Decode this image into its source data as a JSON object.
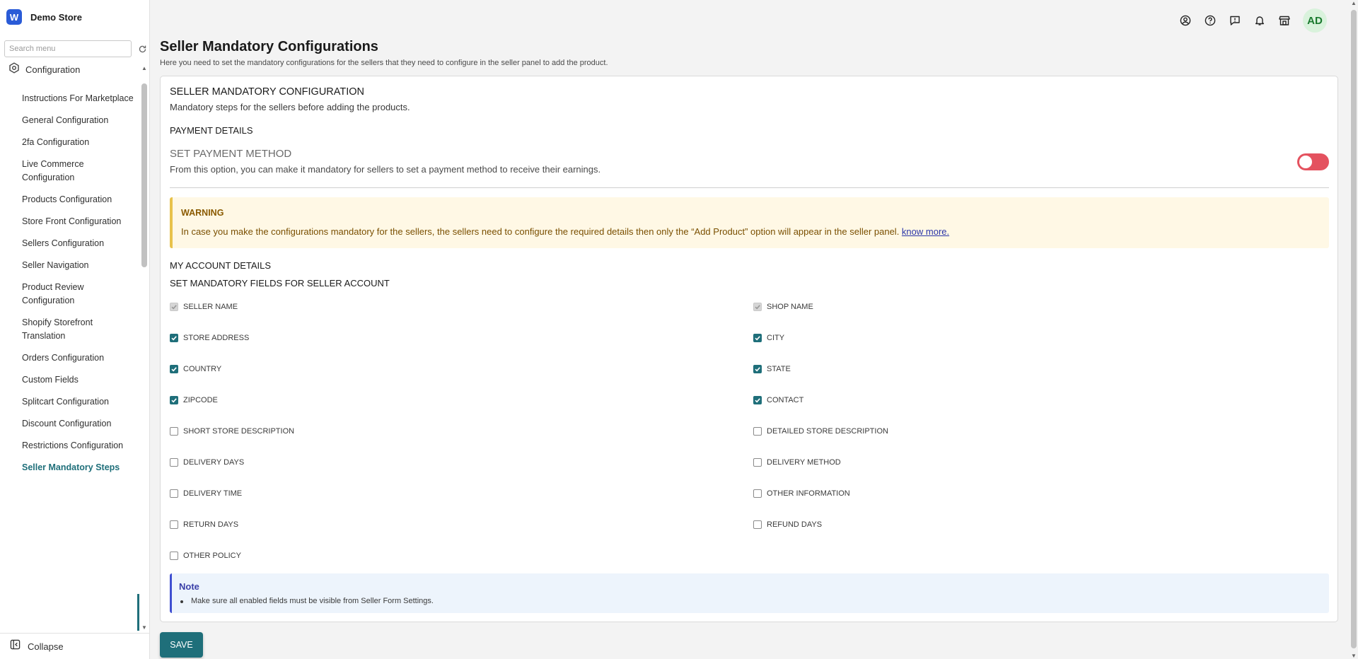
{
  "brand": {
    "name": "Demo Store",
    "logo_text": "W"
  },
  "sidebar": {
    "search_placeholder": "Search menu",
    "section_label": "Configuration",
    "items": [
      {
        "label": "Instructions For Marketplace"
      },
      {
        "label": "General Configuration"
      },
      {
        "label": "2fa Configuration"
      },
      {
        "label": "Live Commerce Configuration"
      },
      {
        "label": "Products Configuration"
      },
      {
        "label": "Store Front Configuration"
      },
      {
        "label": "Sellers Configuration"
      },
      {
        "label": "Seller Navigation"
      },
      {
        "label": "Product Review Configuration"
      },
      {
        "label": "Shopify Storefront Translation"
      },
      {
        "label": "Orders Configuration"
      },
      {
        "label": "Custom Fields"
      },
      {
        "label": "Splitcart Configuration"
      },
      {
        "label": "Discount Configuration"
      },
      {
        "label": "Restrictions Configuration"
      },
      {
        "label": "Seller Mandatory Steps",
        "active": true
      }
    ],
    "collapse_label": "Collapse"
  },
  "topbar": {
    "icons": [
      "user-circle-icon",
      "help-icon",
      "feedback-icon",
      "bell-icon",
      "store-icon"
    ],
    "avatar_initials": "AD"
  },
  "page": {
    "title": "Seller Mandatory Configurations",
    "subtitle": "Here you need to set the mandatory configurations for the sellers that they need to configure in the seller panel to add the product."
  },
  "card": {
    "title": "SELLER MANDATORY CONFIGURATION",
    "subtitle": "Mandatory steps for the sellers before adding the products.",
    "payment_heading": "PAYMENT DETAILS",
    "payment_method_title": "SET PAYMENT METHOD",
    "payment_method_desc": "From this option, you can make it mandatory for sellers to set a payment method to receive their earnings.",
    "payment_toggle_on": false,
    "warning": {
      "title": "WARNING",
      "text": "In case you make the configurations mandatory for the sellers, the sellers need to configure the required details then only the “Add Product” option will appear in the seller panel. ",
      "link": "know more."
    },
    "account_heading": "MY ACCOUNT DETAILS",
    "fields_heading": "SET MANDATORY FIELDS FOR SELLER ACCOUNT",
    "fields": [
      {
        "label": "SELLER NAME",
        "checked": true,
        "disabled": true
      },
      {
        "label": "SHOP NAME",
        "checked": true,
        "disabled": true
      },
      {
        "label": "STORE ADDRESS",
        "checked": true,
        "disabled": false
      },
      {
        "label": "CITY",
        "checked": true,
        "disabled": false
      },
      {
        "label": "COUNTRY",
        "checked": true,
        "disabled": false
      },
      {
        "label": "STATE",
        "checked": true,
        "disabled": false
      },
      {
        "label": "ZIPCODE",
        "checked": true,
        "disabled": false
      },
      {
        "label": "CONTACT",
        "checked": true,
        "disabled": false
      },
      {
        "label": "SHORT STORE DESCRIPTION",
        "checked": false,
        "disabled": false
      },
      {
        "label": "DETAILED STORE DESCRIPTION",
        "checked": false,
        "disabled": false
      },
      {
        "label": "DELIVERY DAYS",
        "checked": false,
        "disabled": false
      },
      {
        "label": "DELIVERY METHOD",
        "checked": false,
        "disabled": false
      },
      {
        "label": "DELIVERY TIME",
        "checked": false,
        "disabled": false
      },
      {
        "label": "OTHER INFORMATION",
        "checked": false,
        "disabled": false
      },
      {
        "label": "RETURN DAYS",
        "checked": false,
        "disabled": false
      },
      {
        "label": "REFUND DAYS",
        "checked": false,
        "disabled": false
      },
      {
        "label": "OTHER POLICY",
        "checked": false,
        "disabled": false
      }
    ],
    "note": {
      "title": "Note",
      "text": "Make sure all enabled fields must be visible from Seller Form Settings."
    }
  },
  "save_label": "SAVE",
  "colors": {
    "accent": "#1f6f7a",
    "toggle_off": "#e4525f",
    "warning_bg": "#fff8e5",
    "note_bg": "#edf4fc"
  }
}
